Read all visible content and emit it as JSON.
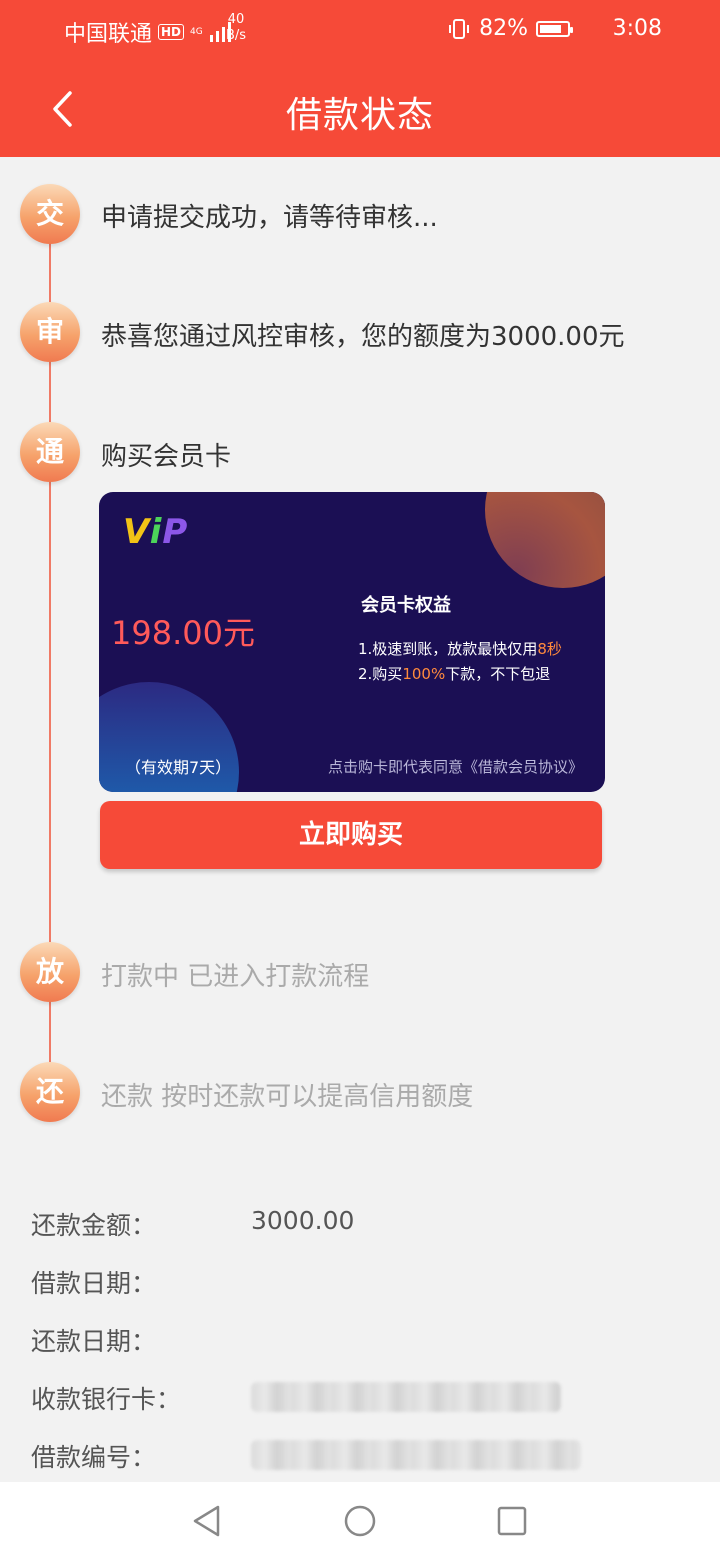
{
  "status_bar": {
    "carrier": "中国联通",
    "hd": "HD",
    "network": "4G",
    "speed_value": "40",
    "speed_unit": "B/s",
    "battery": "82%",
    "time": "3:08"
  },
  "header": {
    "title": "借款状态"
  },
  "timeline": {
    "steps": [
      {
        "badge": "交",
        "text": "申请提交成功，请等待审核..."
      },
      {
        "badge": "审",
        "text": "恭喜您通过风控审核，您的额度为3000.00元"
      },
      {
        "badge": "通",
        "text": "购买会员卡"
      },
      {
        "badge": "放",
        "text": "打款中 已进入打款流程"
      },
      {
        "badge": "还",
        "text": "还款 按时还款可以提高信用额度"
      }
    ]
  },
  "vip_card": {
    "logo_v": "V",
    "logo_i": "i",
    "logo_p": "P",
    "price": "198.00元",
    "validity": "（有效期7天）",
    "benefits_title": "会员卡权益",
    "benefit1_prefix": "1.极速到账，放款最快仅用",
    "benefit1_highlight": "8秒",
    "benefit2_prefix": "2.购买",
    "benefit2_highlight": "100%",
    "benefit2_suffix": "下款，不下包退",
    "agreement": "点击购卡即代表同意《借款会员协议》",
    "buy_button": "立即购买"
  },
  "loan_info": {
    "repay_amount_label": "还款金额：",
    "repay_amount_value": "3000.00",
    "loan_date_label": "借款日期：",
    "repay_date_label": "还款日期：",
    "bank_card_label": "收款银行卡：",
    "loan_number_label": "借款编号："
  },
  "colors": {
    "primary": "#f64a38",
    "card_bg": "#1b0f54",
    "price": "#ff5a5a",
    "highlight": "#ff8a3d"
  }
}
